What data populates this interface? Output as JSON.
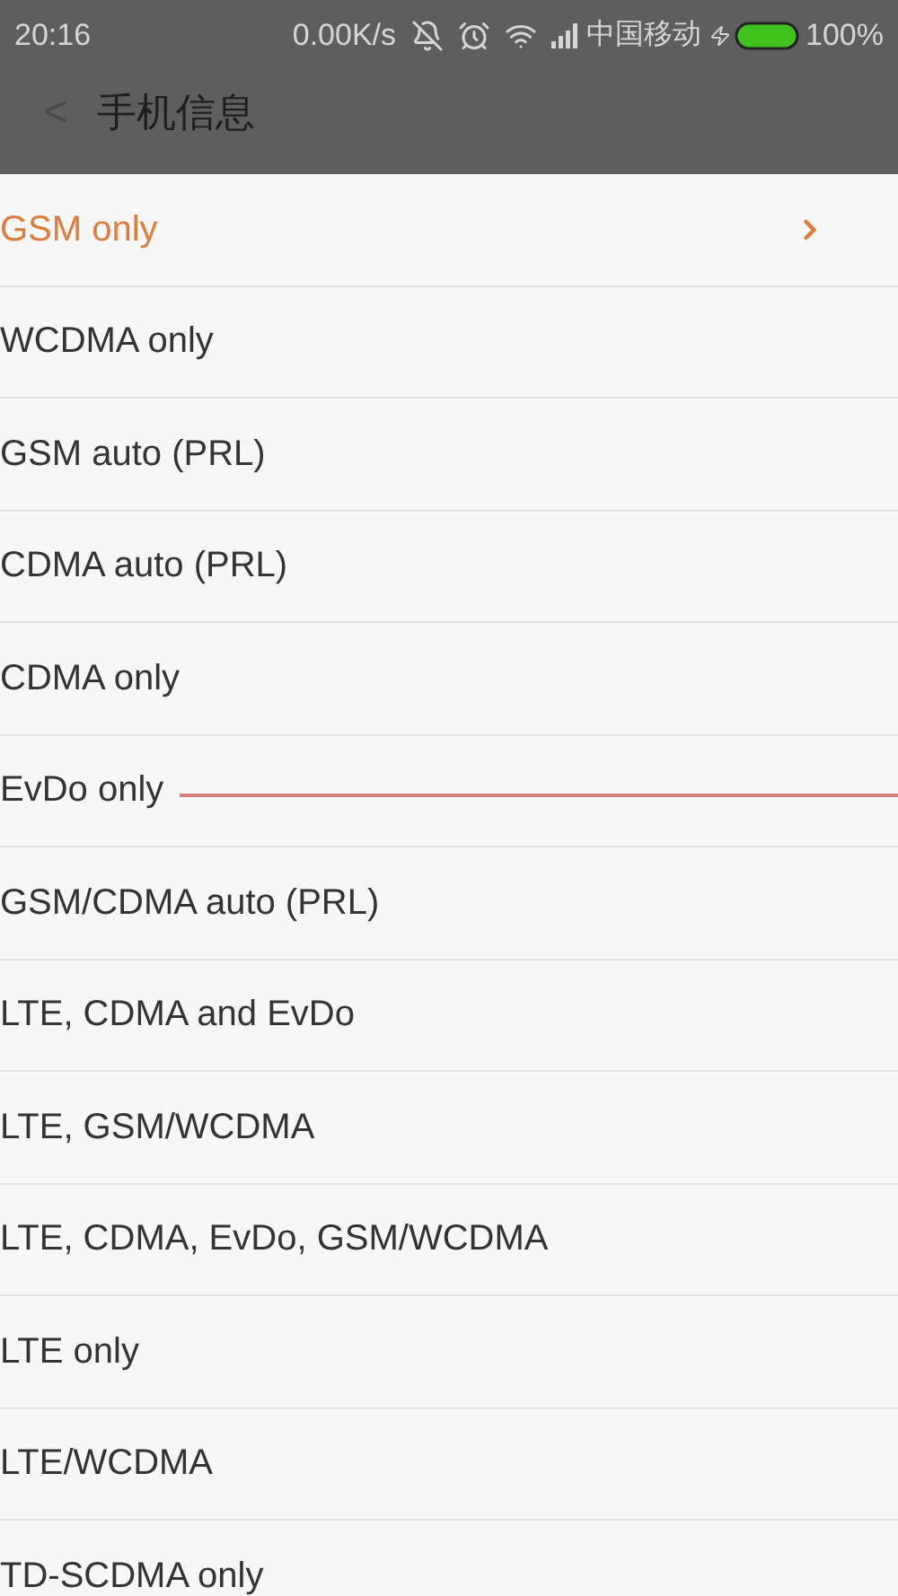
{
  "status_bar": {
    "time": "20:16",
    "speed": "0.00K/s",
    "carrier": "中国移动",
    "battery": "100%"
  },
  "header": {
    "back": "<",
    "title": "手机信息"
  },
  "options": [
    {
      "label": "GSM only",
      "selected": true
    },
    {
      "label": "WCDMA only",
      "selected": false
    },
    {
      "label": "GSM auto (PRL)",
      "selected": false
    },
    {
      "label": "CDMA auto (PRL)",
      "selected": false
    },
    {
      "label": "CDMA only",
      "selected": false
    },
    {
      "label": "EvDo only",
      "selected": false
    },
    {
      "label": "GSM/CDMA auto (PRL)",
      "selected": false
    },
    {
      "label": "LTE, CDMA and EvDo",
      "selected": false
    },
    {
      "label": "LTE, GSM/WCDMA",
      "selected": false
    },
    {
      "label": "LTE, CDMA, EvDo, GSM/WCDMA",
      "selected": false
    },
    {
      "label": "LTE only",
      "selected": false
    },
    {
      "label": "LTE/WCDMA",
      "selected": false
    },
    {
      "label": "TD-SCDMA only",
      "selected": false
    }
  ]
}
